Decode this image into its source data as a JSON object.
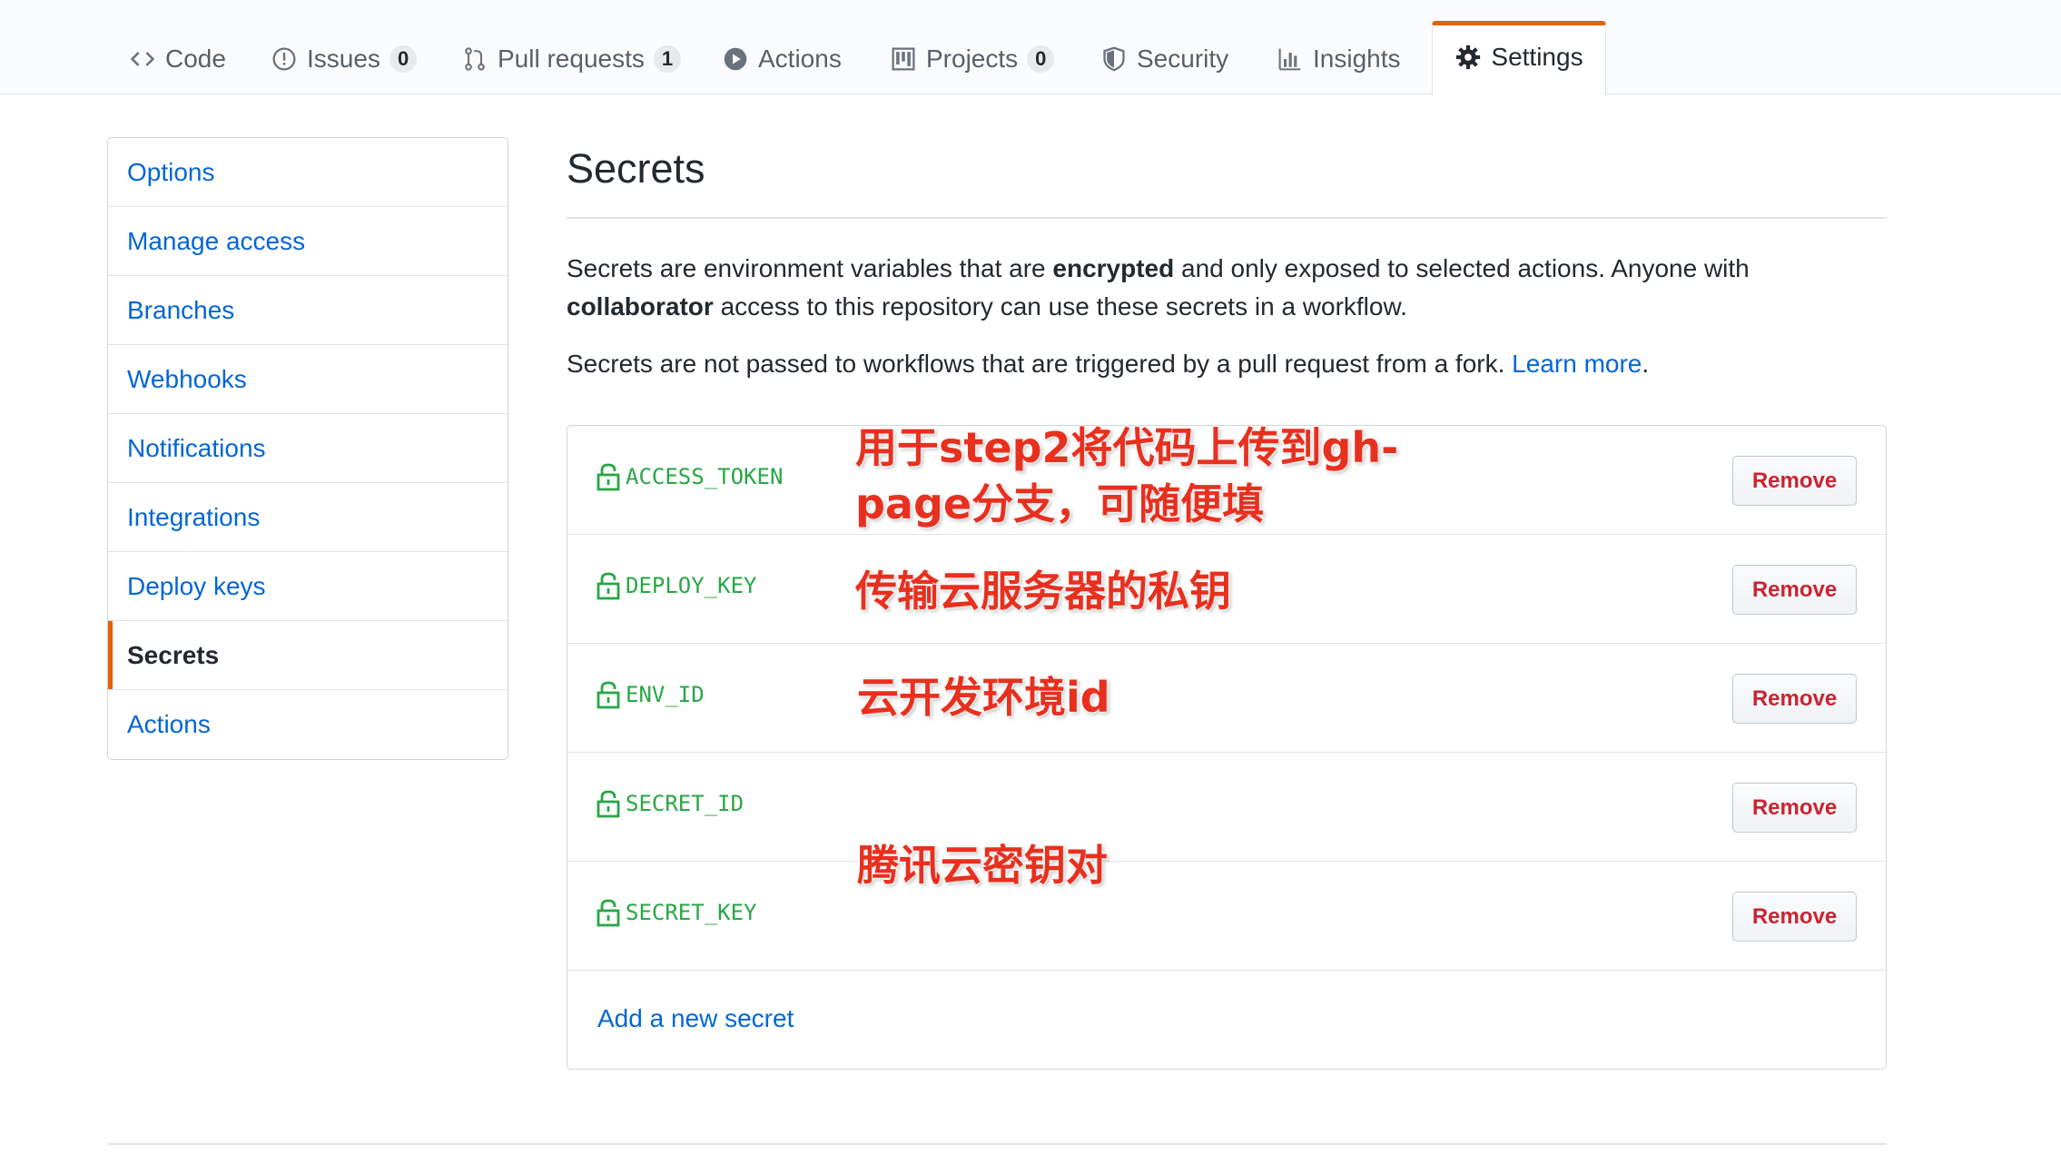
{
  "nav": {
    "tabs": [
      {
        "label": "Code",
        "icon": "code-icon"
      },
      {
        "label": "Issues",
        "icon": "issue-icon",
        "count": "0"
      },
      {
        "label": "Pull requests",
        "icon": "pull-request-icon",
        "count": "1"
      },
      {
        "label": "Actions",
        "icon": "play-icon"
      },
      {
        "label": "Projects",
        "icon": "project-icon",
        "count": "0"
      },
      {
        "label": "Security",
        "icon": "shield-icon"
      },
      {
        "label": "Insights",
        "icon": "graph-icon"
      },
      {
        "label": "Settings",
        "icon": "gear-icon",
        "selected": true
      }
    ]
  },
  "sidebar": {
    "items": [
      {
        "label": "Options"
      },
      {
        "label": "Manage access"
      },
      {
        "label": "Branches"
      },
      {
        "label": "Webhooks"
      },
      {
        "label": "Notifications"
      },
      {
        "label": "Integrations"
      },
      {
        "label": "Deploy keys"
      },
      {
        "label": "Secrets",
        "selected": true
      },
      {
        "label": "Actions"
      }
    ]
  },
  "main": {
    "title": "Secrets",
    "desc1": {
      "p1": "Secrets are environment variables that are ",
      "b1": "encrypted",
      "p2": " and only exposed to selected actions. Anyone with",
      "b2": "collaborator",
      "p3": " access to this repository can use these secrets in a workflow."
    },
    "desc2": {
      "text": "Secrets are not passed to workflows that are triggered by a pull request from a fork. ",
      "link": "Learn more",
      "end": "."
    },
    "secrets": [
      {
        "name": "ACCESS_TOKEN",
        "button": "Remove"
      },
      {
        "name": "DEPLOY_KEY",
        "button": "Remove"
      },
      {
        "name": "ENV_ID",
        "button": "Remove"
      },
      {
        "name": "SECRET_ID",
        "button": "Remove"
      },
      {
        "name": "SECRET_KEY",
        "button": "Remove"
      }
    ],
    "add_secret": "Add a new secret"
  },
  "annotations": {
    "access_token_line1": "用于step2将代码上传到gh-",
    "access_token_line2": "page分支，可随便填",
    "deploy_key": "传输云服务器的私钥",
    "env_id": "云开发环境id",
    "secret_pair": "腾讯云密钥对"
  },
  "colors": {
    "link": "#0366d6",
    "selected_accent": "#e36209",
    "secret_name": "#28a745",
    "remove": "#cb2431",
    "annotation": "#e8301f"
  }
}
